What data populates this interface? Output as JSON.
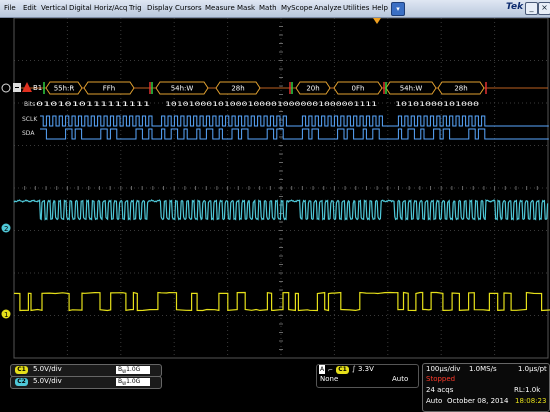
{
  "menu": {
    "items": [
      "File",
      "Edit",
      "Vertical",
      "Digital",
      "Horiz/Acq",
      "Trig",
      "Display",
      "Cursors",
      "Measure",
      "Mask",
      "Math",
      "MyScope",
      "Analyze",
      "Utilities",
      "Help"
    ],
    "dropdown_glyph": "▾",
    "brand": "Tek",
    "minimize": "_",
    "close": "×"
  },
  "bus": {
    "label": "B1",
    "packets": [
      "55h:R",
      "FFh",
      "54h:W",
      "28h",
      "20h",
      "0Fh",
      "54h:W",
      "28h"
    ],
    "bits_label": "Bits",
    "bits_1": "0101010111111111",
    "bits_2": "101010001010001000010000001000001111",
    "bits_3": "10101000101000",
    "sclk_label": "SCLK",
    "sda_label": "SDA"
  },
  "markers": {
    "ch2": "2",
    "ch1": "1"
  },
  "channels": [
    {
      "badge": "C1",
      "scale": "5.0V/div",
      "bw": "1.0G",
      "color": "#e6e01a"
    },
    {
      "badge": "C2",
      "scale": "5.0V/div",
      "bw": "1.0G",
      "color": "#4fc8d8"
    }
  ],
  "trigger": {
    "label": "A",
    "badge": "C1",
    "level": "3.3V",
    "coupling": "None",
    "mode": "Auto"
  },
  "acquisition": {
    "timebase": "100µs/div",
    "sample_rate": "1.0MS/s",
    "resolution": "1.0µs/pt",
    "state": "Stopped",
    "acqs": "24 acqs",
    "record_length": "RL:1.0k",
    "trigger_mode": "Auto",
    "date": "October 08, 2014",
    "time": "18:08:23"
  },
  "colors": {
    "ch1": "#e6e01a",
    "ch2": "#4fc8d8",
    "bus_text": "#ffffff",
    "bus_ok": "#e0a030",
    "stopped": "#ff3a2a",
    "time": "#e6e01a"
  }
}
